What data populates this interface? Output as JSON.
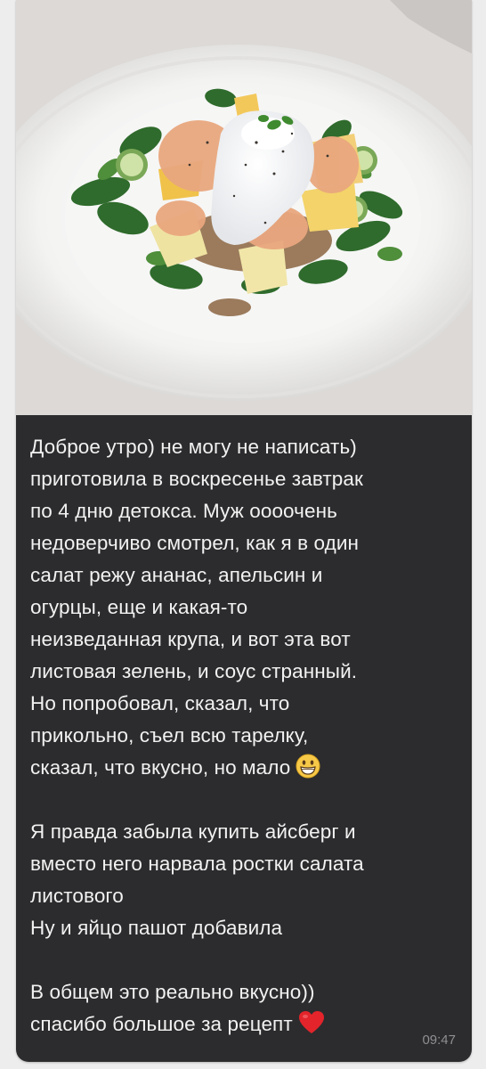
{
  "message": {
    "paragraph1": [
      "Доброе утро) не могу не написать)",
      "приготовила в воскресенье завтрак",
      "по 4 дню детокса. Муж оооочень",
      "недоверчиво смотрел, как я в один",
      "салат режу ананас, апельсин и",
      "огурцы, еще и какая-то",
      "неизведанная крупа, и вот эта вот",
      "листовая зелень, и соус странный.",
      "Но попробовал, сказал, что",
      "прикольно, съел всю тарелку,",
      "сказал, что вкусно, но мало"
    ],
    "paragraph2": [
      "Я правда забыла купить айсберг и",
      "вместо него нарвала ростки салата",
      "листового",
      "Ну и яйцо пашот добавила"
    ],
    "paragraph3": [
      "В общем это реально вкусно))",
      "спасибо большое за рецепт"
    ],
    "emoji_1": "grinning-face-emoji",
    "emoji_2": "red-heart-emoji",
    "time": "09:47"
  },
  "colors": {
    "bubble_bg": "#2c2c2e",
    "text": "#f2f2f2",
    "time": "#8e8e93",
    "chat_bg": "#ededed"
  }
}
